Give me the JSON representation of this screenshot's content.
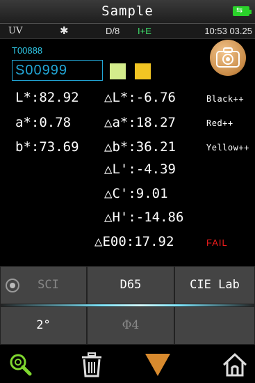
{
  "header": {
    "title": "Sample"
  },
  "status": {
    "uv": "UV",
    "geometry": "D/8",
    "mode": "I+E",
    "time": "10:53 03.25"
  },
  "ids": {
    "standard": "T00888",
    "sample": "S00999"
  },
  "colors": {
    "swatch_standard": "#d4ec8c",
    "swatch_sample": "#f2c523",
    "accent": "#22a6d6",
    "fail": "#f01c1c"
  },
  "measurements": {
    "L": "L*:82.92",
    "a": "a*:0.78",
    "b": "b*:73.69",
    "dL": "△L*:-6.76",
    "da": "△a*:18.27",
    "db": "△b*:36.21",
    "dLp": "△L':-4.39",
    "dCp": "△C':9.01",
    "dHp": "△H':-14.86",
    "dE00": "△E00:17.92"
  },
  "notes": {
    "l": "Black++",
    "a": "Red++",
    "b": "Yellow++"
  },
  "result": "FAIL",
  "settings": {
    "mode": "SCI",
    "illuminant": "D65",
    "space": "CIE Lab",
    "observer": "2°",
    "aperture": "Φ4"
  },
  "toolbar": {
    "icons": [
      "search-icon",
      "trash-icon",
      "down-arrow-icon",
      "home-icon"
    ]
  }
}
